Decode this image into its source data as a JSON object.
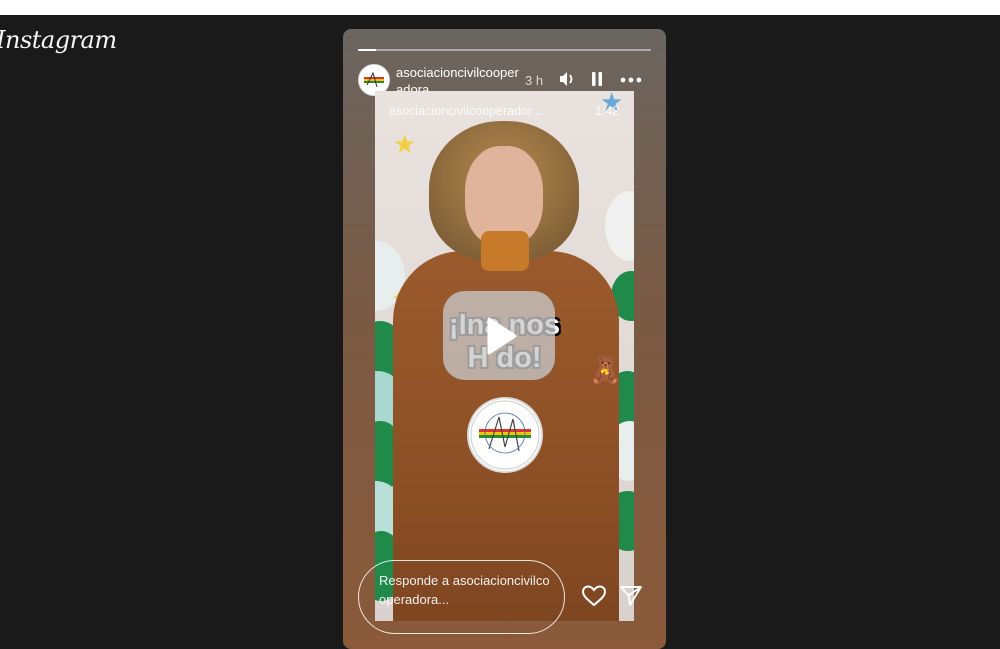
{
  "app": {
    "logo_text": "Instagram"
  },
  "story": {
    "progress_fraction": 0.06,
    "username": "asociacioncivilcooperadora",
    "time_ago": "3 h",
    "sub_username": "asociacioncivilcooperador...",
    "duration": "1:42",
    "headline_line1": "¡Ina          nos",
    "headline_line2": "H          do!",
    "reply_placeholder": "Responde a asociacioncivilcooperadora...",
    "controls": {
      "volume_icon": "volume-icon",
      "pause_icon": "pause-icon",
      "more_icon": "more-options-icon",
      "play_icon": "play-icon",
      "like_icon": "heart-icon",
      "share_icon": "send-icon"
    }
  }
}
